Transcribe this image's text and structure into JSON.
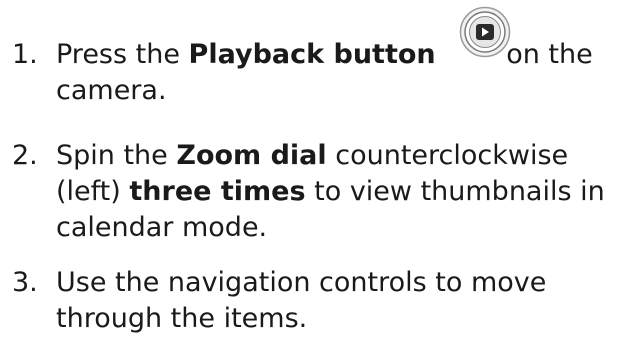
{
  "steps": [
    {
      "number": "1.",
      "line1_before": "Press the ",
      "line1_bold": "Playback button",
      "line1_after": " on the",
      "line2": "camera.",
      "icon": "playback-button-icon"
    },
    {
      "number": "2.",
      "line1_before": "Spin the ",
      "line1_bold": "Zoom dial",
      "line1_after": " counterclockwise",
      "line2_before": "(left) ",
      "line2_bold": "three times",
      "line2_after": " to view thumbnails in",
      "line3": "calendar mode."
    },
    {
      "number": "3.",
      "line1": "Use the navigation controls to move",
      "line2": "through the items."
    }
  ]
}
